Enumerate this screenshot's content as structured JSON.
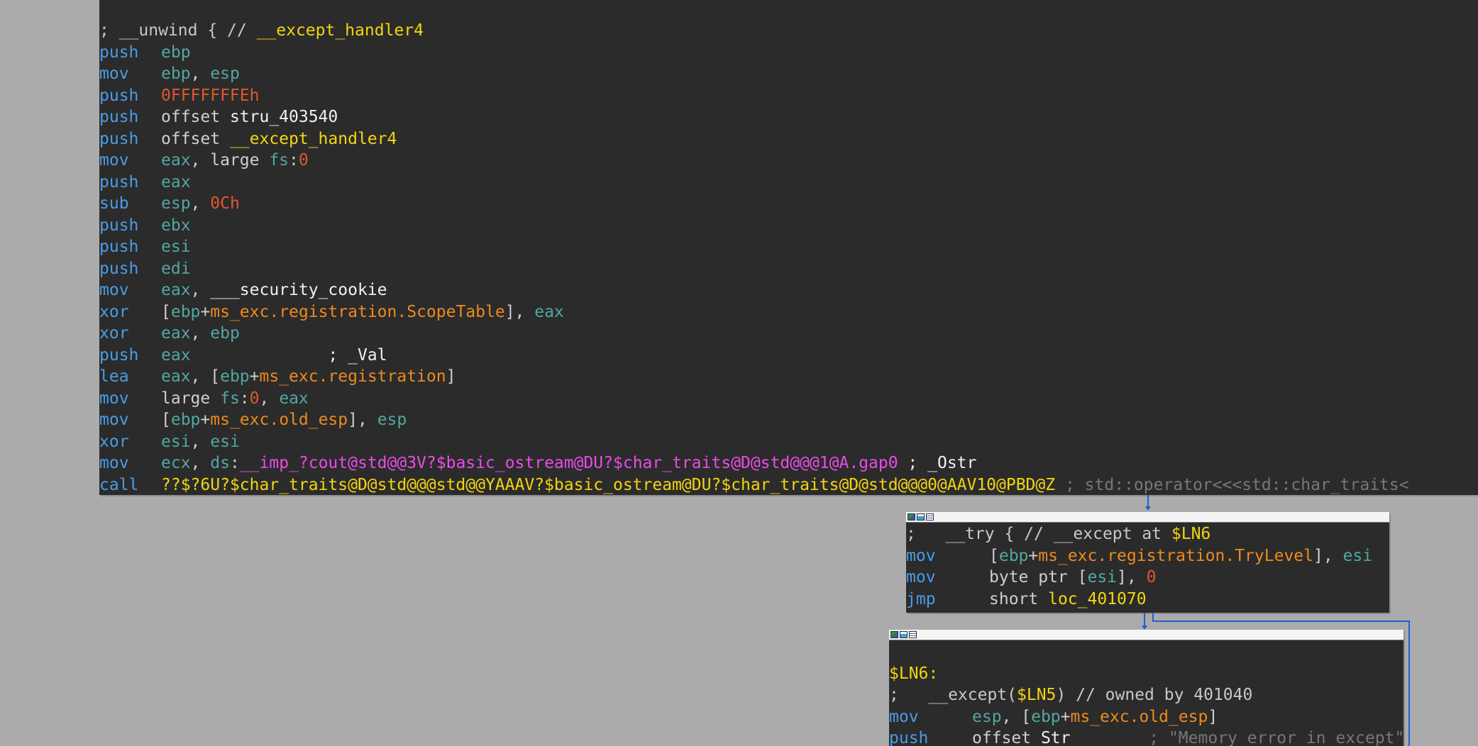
{
  "block1": {
    "lines": [
      {
        "type": "comment",
        "text": "; __unwind { // ",
        "name": "__except_handler4"
      },
      {
        "m": "push",
        "ops": [
          {
            "c": "reg",
            "t": "ebp"
          }
        ]
      },
      {
        "m": "mov",
        "ops": [
          {
            "c": "reg",
            "t": "ebp"
          },
          {
            "c": "plain",
            "t": ", "
          },
          {
            "c": "reg",
            "t": "esp"
          }
        ]
      },
      {
        "m": "push",
        "ops": [
          {
            "c": "num",
            "t": "0FFFFFFFEh"
          }
        ]
      },
      {
        "m": "push",
        "ops": [
          {
            "c": "plain",
            "t": "offset "
          },
          {
            "c": "white",
            "t": "stru_403540"
          }
        ]
      },
      {
        "m": "push",
        "ops": [
          {
            "c": "plain",
            "t": "offset "
          },
          {
            "c": "fn",
            "t": "__except_handler4"
          }
        ]
      },
      {
        "m": "mov",
        "ops": [
          {
            "c": "reg",
            "t": "eax"
          },
          {
            "c": "plain",
            "t": ", large "
          },
          {
            "c": "reg",
            "t": "fs"
          },
          {
            "c": "plain",
            "t": ":"
          },
          {
            "c": "num",
            "t": "0"
          }
        ]
      },
      {
        "m": "push",
        "ops": [
          {
            "c": "reg",
            "t": "eax"
          }
        ]
      },
      {
        "m": "sub",
        "ops": [
          {
            "c": "reg",
            "t": "esp"
          },
          {
            "c": "plain",
            "t": ", "
          },
          {
            "c": "num",
            "t": "0Ch"
          }
        ]
      },
      {
        "m": "push",
        "ops": [
          {
            "c": "reg",
            "t": "ebx"
          }
        ]
      },
      {
        "m": "push",
        "ops": [
          {
            "c": "reg",
            "t": "esi"
          }
        ]
      },
      {
        "m": "push",
        "ops": [
          {
            "c": "reg",
            "t": "edi"
          }
        ]
      },
      {
        "m": "mov",
        "ops": [
          {
            "c": "reg",
            "t": "eax"
          },
          {
            "c": "plain",
            "t": ", "
          },
          {
            "c": "white",
            "t": "___security_cookie"
          }
        ]
      },
      {
        "m": "xor",
        "ops": [
          {
            "c": "plain",
            "t": "["
          },
          {
            "c": "reg",
            "t": "ebp"
          },
          {
            "c": "plain",
            "t": "+"
          },
          {
            "c": "field",
            "t": "ms_exc.registration.ScopeTable"
          },
          {
            "c": "plain",
            "t": "], "
          },
          {
            "c": "reg",
            "t": "eax"
          }
        ]
      },
      {
        "m": "xor",
        "ops": [
          {
            "c": "reg",
            "t": "eax"
          },
          {
            "c": "plain",
            "t": ", "
          },
          {
            "c": "reg",
            "t": "ebp"
          }
        ]
      },
      {
        "m": "push",
        "ops": [
          {
            "c": "reg",
            "t": "eax"
          },
          {
            "c": "plain",
            "t": "              "
          },
          {
            "c": "white",
            "t": "; _Val"
          }
        ]
      },
      {
        "m": "lea",
        "ops": [
          {
            "c": "reg",
            "t": "eax"
          },
          {
            "c": "plain",
            "t": ", ["
          },
          {
            "c": "reg",
            "t": "ebp"
          },
          {
            "c": "plain",
            "t": "+"
          },
          {
            "c": "field",
            "t": "ms_exc.registration"
          },
          {
            "c": "plain",
            "t": "]"
          }
        ]
      },
      {
        "m": "mov",
        "ops": [
          {
            "c": "plain",
            "t": "large "
          },
          {
            "c": "reg",
            "t": "fs"
          },
          {
            "c": "plain",
            "t": ":"
          },
          {
            "c": "num",
            "t": "0"
          },
          {
            "c": "plain",
            "t": ", "
          },
          {
            "c": "reg",
            "t": "eax"
          }
        ]
      },
      {
        "m": "mov",
        "ops": [
          {
            "c": "plain",
            "t": "["
          },
          {
            "c": "reg",
            "t": "ebp"
          },
          {
            "c": "plain",
            "t": "+"
          },
          {
            "c": "field",
            "t": "ms_exc.old_esp"
          },
          {
            "c": "plain",
            "t": "], "
          },
          {
            "c": "reg",
            "t": "esp"
          }
        ]
      },
      {
        "m": "xor",
        "ops": [
          {
            "c": "reg",
            "t": "esi"
          },
          {
            "c": "plain",
            "t": ", "
          },
          {
            "c": "reg",
            "t": "esi"
          }
        ]
      },
      {
        "m": "mov",
        "ops": [
          {
            "c": "reg",
            "t": "ecx"
          },
          {
            "c": "plain",
            "t": ", "
          },
          {
            "c": "reg",
            "t": "ds"
          },
          {
            "c": "plain",
            "t": ":"
          },
          {
            "c": "imp",
            "t": "__imp_?cout@std@@3V?$basic_ostream@DU?$char_traits@D@std@@@1@A.gap0"
          },
          {
            "c": "white",
            "t": " ; _Ostr"
          }
        ]
      },
      {
        "m": "call",
        "ops": [
          {
            "c": "fn",
            "t": "??$?6U?$char_traits@D@std@@@std@@YAAAV?$basic_ostream@DU?$char_traits@D@std@@@0@AAV10@PBD@Z"
          },
          {
            "c": "cmt",
            "t": " ; std::operator<<<std::char_traits<"
          }
        ]
      }
    ]
  },
  "block2": {
    "lines": [
      {
        "type": "comment",
        "text": ";   __try { // __except at ",
        "name": "$LN6"
      },
      {
        "m": "mov",
        "w": 117,
        "ops": [
          {
            "c": "plain",
            "t": "["
          },
          {
            "c": "reg",
            "t": "ebp"
          },
          {
            "c": "plain",
            "t": "+"
          },
          {
            "c": "field",
            "t": "ms_exc.registration.TryLevel"
          },
          {
            "c": "plain",
            "t": "], "
          },
          {
            "c": "reg",
            "t": "esi"
          }
        ]
      },
      {
        "m": "mov",
        "w": 117,
        "ops": [
          {
            "c": "plain",
            "t": "byte ptr ["
          },
          {
            "c": "reg",
            "t": "esi"
          },
          {
            "c": "plain",
            "t": "], "
          },
          {
            "c": "num",
            "t": "0"
          }
        ]
      },
      {
        "m": "jmp",
        "w": 117,
        "ops": [
          {
            "c": "plain",
            "t": "short "
          },
          {
            "c": "lbl",
            "t": "loc_401070"
          }
        ]
      }
    ]
  },
  "block3": {
    "lines": [
      {
        "type": "blank"
      },
      {
        "type": "label",
        "text": "$LN6:"
      },
      {
        "type": "comment2",
        "pre": ";   __except(",
        "name": "$LN5",
        "post": ") // owned by 401040"
      },
      {
        "m": "mov",
        "w": 117,
        "ops": [
          {
            "c": "reg",
            "t": "esp"
          },
          {
            "c": "plain",
            "t": ", ["
          },
          {
            "c": "reg",
            "t": "ebp"
          },
          {
            "c": "plain",
            "t": "+"
          },
          {
            "c": "field",
            "t": "ms_exc.old_esp"
          },
          {
            "c": "plain",
            "t": "]"
          }
        ]
      },
      {
        "m": "push",
        "w": 117,
        "ops": [
          {
            "c": "plain",
            "t": "offset "
          },
          {
            "c": "white",
            "t": "Str"
          },
          {
            "c": "cmt",
            "t": "        ; \"Memory error in except\""
          }
        ]
      }
    ]
  }
}
